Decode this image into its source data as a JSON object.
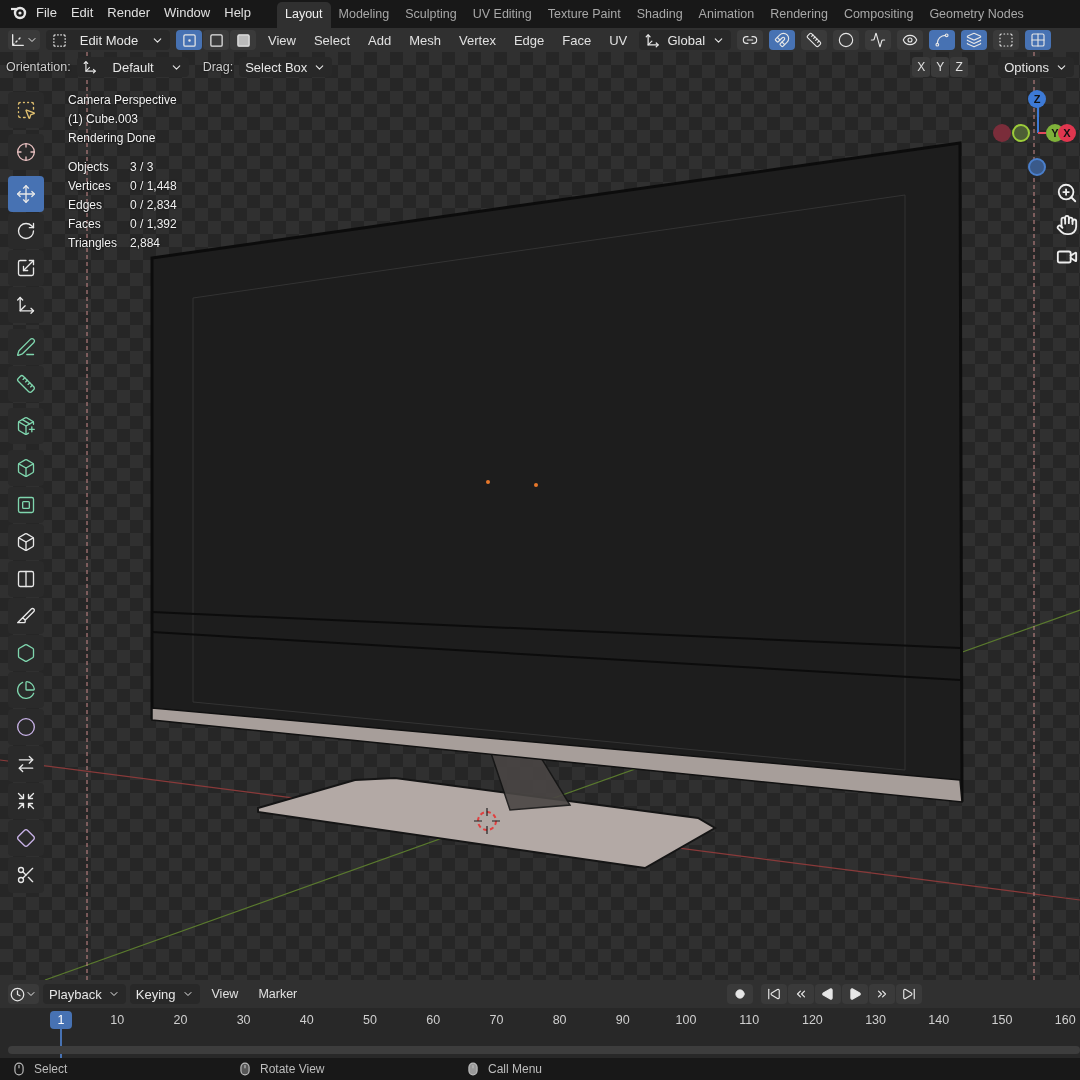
{
  "menu_bar": {
    "menus": [
      "File",
      "Edit",
      "Render",
      "Window",
      "Help"
    ],
    "workspaces": [
      {
        "label": "Layout",
        "selected": true
      },
      {
        "label": "Modeling",
        "selected": false
      },
      {
        "label": "Sculpting",
        "selected": false
      },
      {
        "label": "UV Editing",
        "selected": false
      },
      {
        "label": "Texture Paint",
        "selected": false
      },
      {
        "label": "Shading",
        "selected": false
      },
      {
        "label": "Animation",
        "selected": false
      },
      {
        "label": "Rendering",
        "selected": false
      },
      {
        "label": "Compositing",
        "selected": false
      },
      {
        "label": "Geometry Nodes",
        "selected": false
      }
    ]
  },
  "header": {
    "mode": "Edit Mode",
    "select_modes": [
      {
        "kind": "vertex",
        "selected": true
      },
      {
        "kind": "edge",
        "selected": false
      },
      {
        "kind": "face",
        "selected": false
      }
    ],
    "menus": [
      "View",
      "Select",
      "Add",
      "Mesh",
      "Vertex",
      "Edge",
      "Face",
      "UV"
    ],
    "orientation": "Global",
    "toggles": [
      {
        "kind": "pivot",
        "on": false
      },
      {
        "kind": "snap",
        "on": true
      },
      {
        "kind": "snap-target",
        "on": false
      },
      {
        "kind": "proportional",
        "on": false
      },
      {
        "kind": "falloff",
        "on": false
      },
      {
        "kind": "visibility",
        "on": false
      },
      {
        "kind": "gizmo",
        "on": true
      },
      {
        "kind": "overlay",
        "on": true
      },
      {
        "kind": "mesh-overlay",
        "on": false
      },
      {
        "kind": "xray",
        "on": true
      }
    ]
  },
  "tool_settings": {
    "orientation_label": "Orientation:",
    "orientation": "Default",
    "drag_label": "Drag:",
    "drag": "Select Box",
    "axes": [
      "X",
      "Y",
      "Z"
    ],
    "options": "Options"
  },
  "toolbar": {
    "groups": [
      [
        {
          "kind": "select",
          "selected": false
        }
      ],
      [
        {
          "kind": "cursor",
          "selected": false
        }
      ],
      [
        {
          "kind": "move",
          "selected": true
        },
        {
          "kind": "rotate",
          "selected": false
        },
        {
          "kind": "scale",
          "selected": false
        },
        {
          "kind": "transform",
          "selected": false
        }
      ],
      [
        {
          "kind": "annotate",
          "selected": false
        },
        {
          "kind": "measure",
          "selected": false
        }
      ],
      [
        {
          "kind": "add-cube",
          "selected": false
        }
      ],
      [
        {
          "kind": "extrude",
          "selected": false
        },
        {
          "kind": "inset",
          "selected": false
        },
        {
          "kind": "bevel",
          "selected": false
        },
        {
          "kind": "loop-cut",
          "selected": false
        },
        {
          "kind": "knife",
          "selected": false
        },
        {
          "kind": "poly-build",
          "selected": false
        },
        {
          "kind": "spin",
          "selected": false
        },
        {
          "kind": "smooth",
          "selected": false
        },
        {
          "kind": "edge-slide",
          "selected": false
        },
        {
          "kind": "shrink",
          "selected": false
        },
        {
          "kind": "shear",
          "selected": false
        },
        {
          "kind": "rip",
          "selected": false
        }
      ]
    ]
  },
  "viewport_info": {
    "lines": [
      "Camera Perspective",
      "(1) Cube.003",
      "Rendering Done"
    ],
    "stats": [
      {
        "label": "Objects",
        "value": "3 / 3"
      },
      {
        "label": "Vertices",
        "value": "0 / 1,448"
      },
      {
        "label": "Edges",
        "value": "0 / 2,834"
      },
      {
        "label": "Faces",
        "value": "0 / 1,392"
      },
      {
        "label": "Triangles",
        "value": "2,884"
      }
    ]
  },
  "gizmo": {
    "axes": [
      {
        "kind": "z",
        "label": "Z"
      },
      {
        "kind": "y",
        "label": "Y"
      },
      {
        "kind": "x",
        "label": "X"
      }
    ]
  },
  "timeline": {
    "menus": [
      "Playback",
      "Keying",
      "View",
      "Marker"
    ],
    "current_frame": "1",
    "ticks": [
      "10",
      "20",
      "30",
      "40",
      "50",
      "60",
      "70",
      "80",
      "90",
      "100",
      "110",
      "120",
      "130",
      "140",
      "150",
      "160"
    ]
  },
  "status_bar": [
    {
      "kind": "left-click",
      "label": "Select"
    },
    {
      "kind": "middle-click",
      "label": "Rotate View"
    },
    {
      "kind": "right-click",
      "label": "Call Menu"
    }
  ]
}
